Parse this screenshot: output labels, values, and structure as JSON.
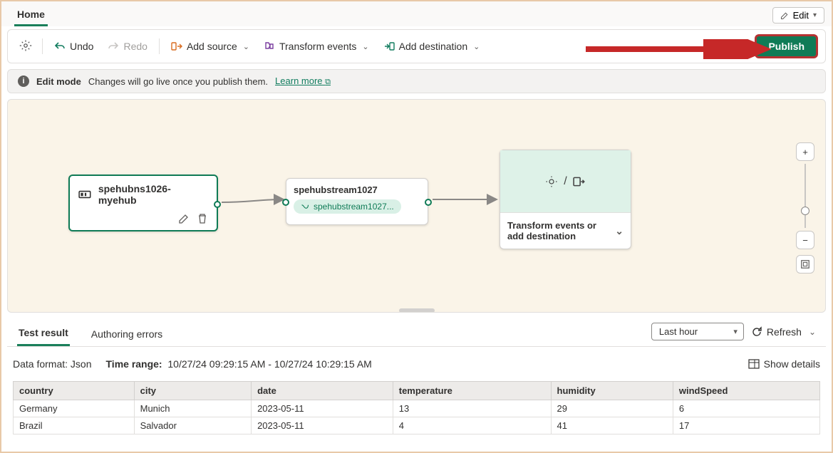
{
  "tabs": {
    "home": "Home"
  },
  "topright": {
    "edit": "Edit"
  },
  "toolbar": {
    "undo": "Undo",
    "redo": "Redo",
    "add_source": "Add source",
    "transform": "Transform events",
    "add_dest": "Add destination",
    "publish": "Publish"
  },
  "banner": {
    "title": "Edit mode",
    "text": "Changes will go live once you publish them.",
    "link": "Learn more"
  },
  "nodes": {
    "source": {
      "label": "spehubns1026-myehub"
    },
    "stream": {
      "title": "spehubstream1027",
      "tag": "spehubstream1027..."
    },
    "dest": {
      "label": "Transform events or add destination"
    }
  },
  "zoom": {
    "plus": "+",
    "minus": "−"
  },
  "bottom": {
    "tab_test": "Test result",
    "tab_errors": "Authoring errors",
    "range_dd": "Last hour",
    "refresh": "Refresh",
    "data_format_label": "Data format:",
    "data_format_value": "Json",
    "time_range_label": "Time range:",
    "time_range_value": "10/27/24 09:29:15 AM - 10/27/24 10:29:15 AM",
    "show_details": "Show details",
    "columns": [
      "country",
      "city",
      "date",
      "temperature",
      "humidity",
      "windSpeed"
    ],
    "rows": [
      {
        "country": "Germany",
        "city": "Munich",
        "date": "2023-05-11",
        "temperature": "13",
        "humidity": "29",
        "windSpeed": "6"
      },
      {
        "country": "Brazil",
        "city": "Salvador",
        "date": "2023-05-11",
        "temperature": "4",
        "humidity": "41",
        "windSpeed": "17"
      }
    ]
  }
}
